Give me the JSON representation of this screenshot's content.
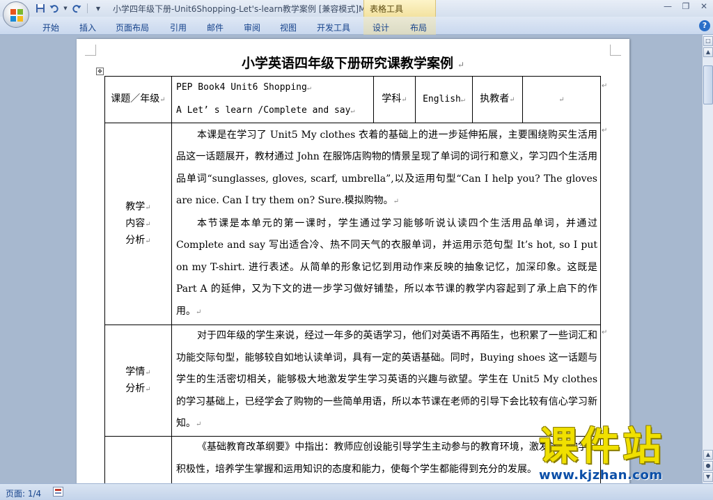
{
  "window": {
    "title": "小学四年级下册-Unit6Shopping-Let's-learn教学案例 [兼容模式]M",
    "context_tab_group": "表格工具",
    "controls": [
      "minimize-icon",
      "restore-icon",
      "close-icon"
    ]
  },
  "quick_access": [
    "save-icon",
    "undo-icon",
    "redo-icon",
    "customize-icon"
  ],
  "ribbon": {
    "tabs": [
      "开始",
      "插入",
      "页面布局",
      "引用",
      "邮件",
      "审阅",
      "视图",
      "开发工具",
      "设计",
      "布局"
    ],
    "help": "?"
  },
  "document": {
    "title": "小学英语四年级下册研究课教学案例",
    "mark": "↵",
    "table": {
      "topic_label": "课题／年级",
      "topic_line1": "PEP Book4 Unit6 Shopping",
      "topic_line2": "A Let’ s learn /Complete and say",
      "subject_label": "学科",
      "subject_value": "English",
      "teacher_label": "执教者",
      "teacher_value": "",
      "content_label": [
        "教学",
        "内容",
        "分析"
      ],
      "content_paras": [
        "本课是在学习了 Unit5 My clothes 衣着的基础上的进一步延伸拓展，主要围绕购买生活用品这一话题展开，教材通过 John 在服饰店购物的情景呈现了单词的词行和意义，学习四个生活用品单词“sunglasses, gloves, scarf, umbrella”,以及运用句型“Can I help you? The gloves are nice.    Can I try them on? Sure.模拟购物。",
        "本节课是本单元的第一课时，学生通过学习能够听说认读四个生活用品单词，并通过 Complete and say 写出适合冷、热不同天气的衣服单词，并运用示范句型 It’s hot, so I put on my T-shirt. 进行表述。从简单的形象记忆到用动作来反映的抽象记忆，加深印象。这既是 Part A 的延伸，又为下文的进一步学习做好铺垫，所以本节课的教学内容起到了承上启下的作用。"
      ],
      "student_label": [
        "学情",
        "分析"
      ],
      "student_paras": [
        "对于四年级的学生来说，经过一年多的英语学习，他们对英语不再陌生，也积累了一些词汇和功能交际句型，能够较自如地认读单词，具有一定的英语基础。同时，Buying shoes 这一话题与学生的生活密切相关，能够极大地激发学生学习英语的兴趣与欲望。学生在 Unit5 My clothes 的学习基础上，已经学会了购物的一些简单用语，所以本节课在老师的引导下会比较有信心学习新知。"
      ],
      "guide_paras": [
        "《基础教育改革纲要》中指出：教师应创设能引导学生主动参与的教育环境，激发学生的学习积极性，培养学生掌握和运用知识的态度和能力，使每个学生都能得到充分的发展。"
      ]
    }
  },
  "status": {
    "page": "页面: 1/4"
  },
  "watermark": {
    "name": "课件站",
    "url": "www.kjzhan.com"
  }
}
